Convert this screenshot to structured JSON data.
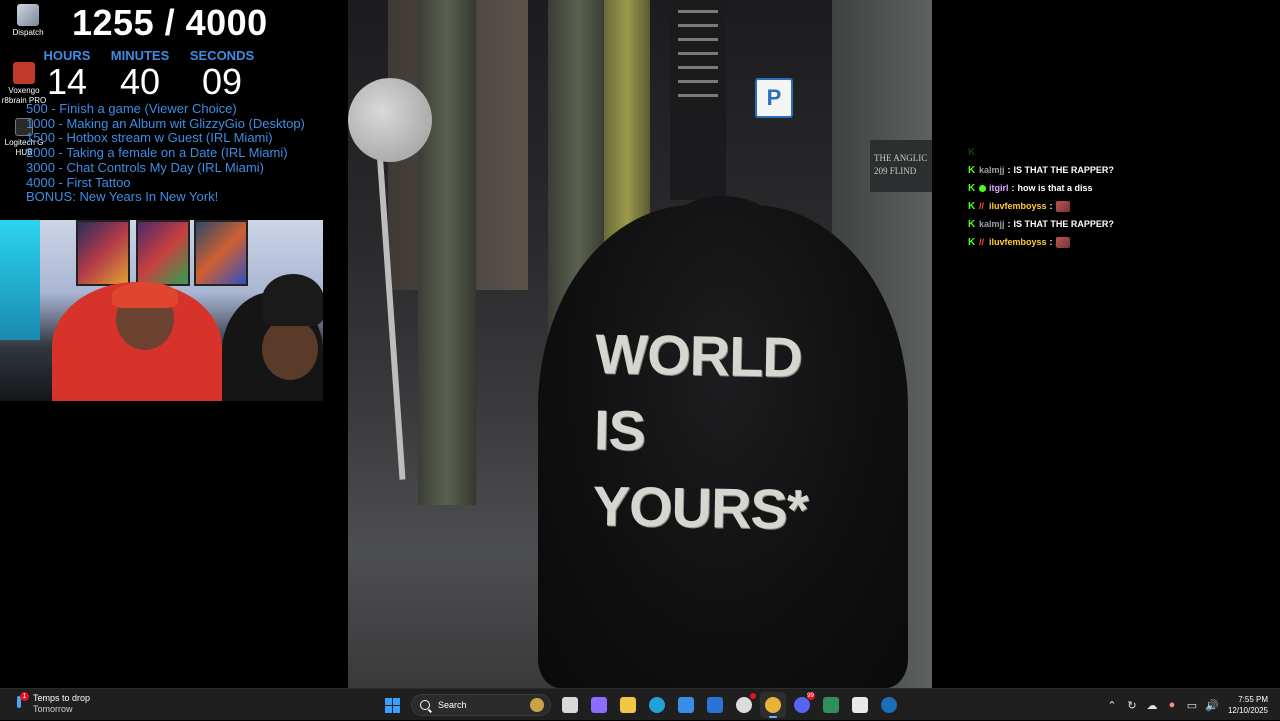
{
  "desktop": {
    "icons": [
      {
        "label": "Dispatch",
        "icon": "dispatch-app-icon"
      },
      {
        "label": "Voxengo r8brain PRO",
        "icon": "voxengo-app-icon"
      },
      {
        "label": "Logitech G HUB",
        "icon": "logitech-app-icon"
      }
    ]
  },
  "overlay": {
    "goal": {
      "current": 1255,
      "target": 4000,
      "text": "1255 / 4000"
    },
    "timer": {
      "hours_label": "HOURS",
      "hours": "14",
      "minutes_label": "MINUTES",
      "minutes": "40",
      "seconds_label": "SECONDS",
      "seconds": "09"
    },
    "goals": [
      "500 -  Finish a game (Viewer Choice)",
      "1000 - Making an Album wit GlizzyGio (Desktop)",
      "1500 - Hotbox stream w Guest (IRL Miami)",
      "2000 - Taking a female on a Date (IRL Miami)",
      "3000 - Chat Controls My Day (IRL Miami)",
      "4000 - First Tattoo",
      "BONUS: New Years In New York!"
    ]
  },
  "stream_photo": {
    "hoodie_text": [
      "WORLD",
      "IS",
      "YOURS*"
    ],
    "parking_sign": "P",
    "building_plate": [
      "THE ANGLIC",
      "209 FLIND"
    ]
  },
  "chat": {
    "messages": [
      {
        "user": "",
        "user_color": "#8a8a8a",
        "text": "",
        "faded": true,
        "badges": [
          "k"
        ]
      },
      {
        "user": "kalmjj",
        "user_color": "#9aa0a6",
        "text": "IS THAT THE RAPPER?",
        "faded": false,
        "badges": [
          "k"
        ]
      },
      {
        "user": "itgirl",
        "user_color": "#e3a6ff",
        "text": "how is that a diss",
        "faded": false,
        "badges": [
          "k",
          "c"
        ]
      },
      {
        "user": "iluvfemboyss",
        "user_color": "#ffcc33",
        "text": "",
        "emote": true,
        "faded": false,
        "badges": [
          "k",
          "s"
        ]
      },
      {
        "user": "kalmjj",
        "user_color": "#9aa0a6",
        "text": "IS THAT THE RAPPER?",
        "faded": false,
        "badges": [
          "k"
        ]
      },
      {
        "user": "iluvfemboyss",
        "user_color": "#ffcc33",
        "text": "",
        "emote": true,
        "faded": false,
        "badges": [
          "k",
          "s"
        ]
      }
    ]
  },
  "taskbar": {
    "weather": {
      "line1": "Temps to drop",
      "line2": "Tomorrow",
      "badge": "1"
    },
    "search_placeholder": "Search",
    "apps": [
      {
        "name": "task-view-icon",
        "color": "#d9d9d9"
      },
      {
        "name": "copilot-icon",
        "color": "#8a6cff"
      },
      {
        "name": "file-explorer-icon",
        "color": "#f2c544"
      },
      {
        "name": "edge-icon",
        "color": "#1fa3d8"
      },
      {
        "name": "store-icon",
        "color": "#3a8ee6"
      },
      {
        "name": "outlook-icon",
        "color": "#2a72d4"
      },
      {
        "name": "obs-icon",
        "color": "#dcdcdc",
        "dot": true
      },
      {
        "name": "chrome-icon",
        "color": "#e8b33a",
        "active": true
      },
      {
        "name": "discord-icon",
        "color": "#5865f2",
        "count": "99"
      },
      {
        "name": "excel-like-icon",
        "color": "#2f8f5a"
      },
      {
        "name": "g-hub-icon",
        "color": "#e8e8e8"
      },
      {
        "name": "steam-icon",
        "color": "#1b6fb7"
      }
    ],
    "clock": {
      "time": "7:55 PM",
      "date": "12/10/2025"
    }
  }
}
